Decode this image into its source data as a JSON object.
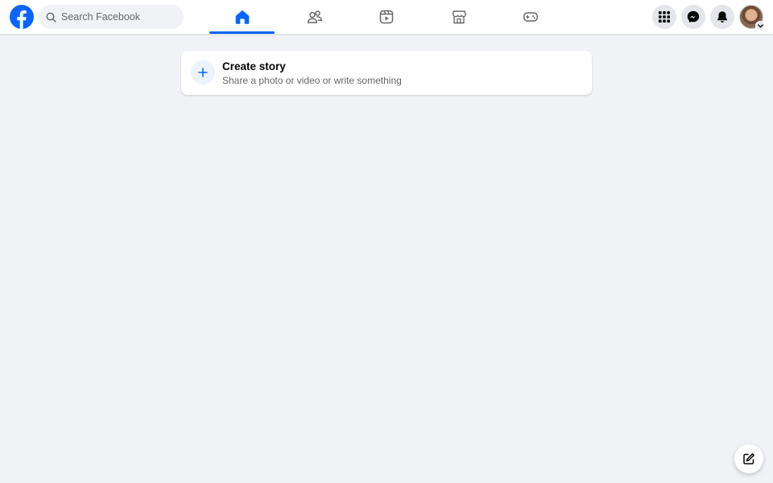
{
  "header": {
    "logo_icon": "facebook-logo-icon",
    "search": {
      "placeholder": "Search Facebook",
      "value": ""
    },
    "nav_tabs": [
      {
        "name": "home",
        "icon": "home-icon",
        "active": true
      },
      {
        "name": "friends",
        "icon": "friends-icon",
        "active": false
      },
      {
        "name": "video",
        "icon": "video-icon",
        "active": false
      },
      {
        "name": "marketplace",
        "icon": "marketplace-icon",
        "active": false
      },
      {
        "name": "gaming",
        "icon": "gaming-icon",
        "active": false
      }
    ],
    "right_buttons": [
      "menu-grid-icon",
      "messenger-icon",
      "bell-icon",
      "account-avatar"
    ]
  },
  "story": {
    "title": "Create story",
    "subtitle": "Share a photo or video or write something"
  },
  "colors": {
    "brand": "#0866ff",
    "background": "#f0f2f5",
    "surface": "#ffffff",
    "secondary_text": "#65676b",
    "button_bg": "#e4e6eb"
  }
}
